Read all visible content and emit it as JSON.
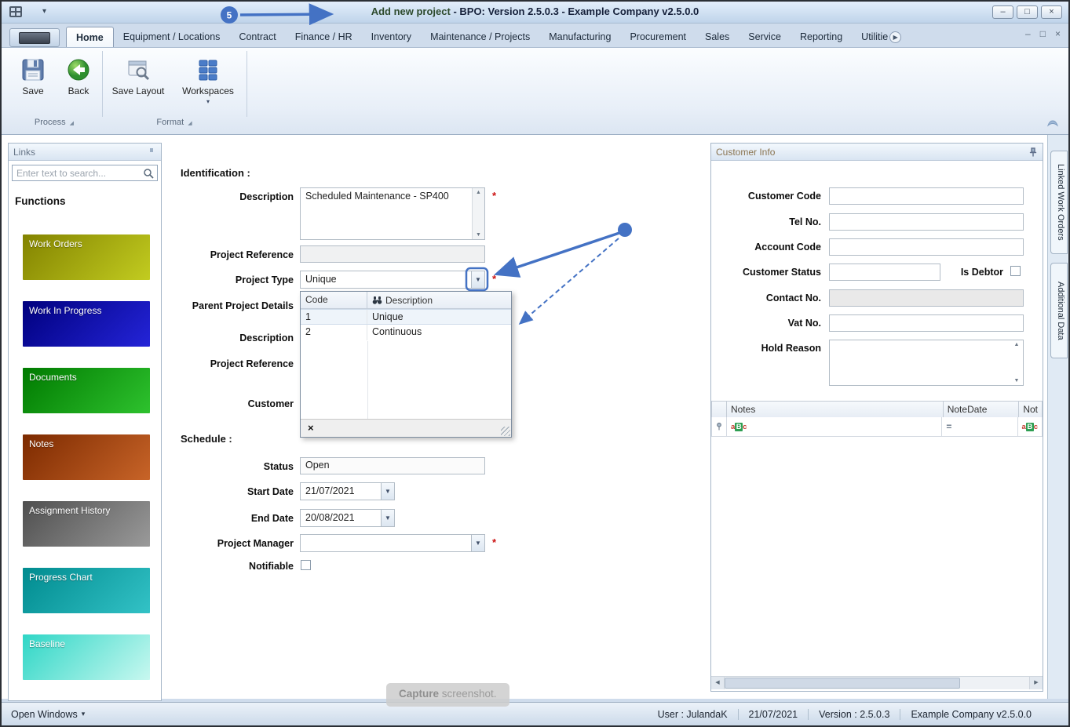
{
  "window": {
    "title_prefix": "Add new project",
    "title_rest": " - BPO: Version 2.5.0.3 - Example Company v2.5.0.0"
  },
  "icons": {
    "minimize": "–",
    "maximize": "□",
    "restore": "□",
    "close": "×",
    "caret_down_small": "▾",
    "dropdown_arrow": "▼",
    "arrow_up": "▲",
    "arrow_down": "▼",
    "arrow_left": "◀",
    "arrow_right": "▶",
    "tab_scroll_right": "▶",
    "dialog_launcher": "◢",
    "close_x": "×",
    "equals": "="
  },
  "ribbon": {
    "tabs": [
      {
        "label": "Home",
        "active": true
      },
      {
        "label": "Equipment / Locations"
      },
      {
        "label": "Contract"
      },
      {
        "label": "Finance / HR"
      },
      {
        "label": "Inventory"
      },
      {
        "label": "Maintenance / Projects"
      },
      {
        "label": "Manufacturing"
      },
      {
        "label": "Procurement"
      },
      {
        "label": "Sales"
      },
      {
        "label": "Service"
      },
      {
        "label": "Reporting"
      },
      {
        "label": "Utilitie"
      }
    ],
    "buttons": {
      "save": "Save",
      "back": "Back",
      "save_layout": "Save Layout",
      "workspaces": "Workspaces"
    },
    "groups": {
      "process": "Process",
      "format": "Format"
    }
  },
  "links": {
    "title": "Links",
    "search_placeholder": "Enter text to search...",
    "heading": "Functions",
    "tiles": [
      {
        "label": "Work Orders",
        "from": "#838300",
        "to": "#c2cc20"
      },
      {
        "label": "Work In Progress",
        "from": "#00007e",
        "to": "#2424d8"
      },
      {
        "label": "Documents",
        "from": "#007a00",
        "to": "#2ec22e"
      },
      {
        "label": "Notes",
        "from": "#7c2a00",
        "to": "#c86428"
      },
      {
        "label": "Assignment History",
        "from": "#4f4f4f",
        "to": "#9a9a9a"
      },
      {
        "label": "Progress Chart",
        "from": "#008b8f",
        "to": "#33c2c6"
      },
      {
        "label": "Baseline",
        "from": "#2fd6c6",
        "to": "#c8f8f0"
      }
    ]
  },
  "form": {
    "section_identification": "Identification :",
    "section_schedule": "Schedule :",
    "required_marker": "*",
    "description_label": "Description",
    "description_value": "Scheduled Maintenance - SP400",
    "project_reference_label": "Project Reference",
    "project_type_label": "Project Type",
    "project_type_value": "Unique",
    "parent_details_label": "Parent Project Details",
    "parent_description_label": "Description",
    "parent_reference_label": "Project Reference",
    "customer_label": "Customer",
    "status_label": "Status",
    "status_value": "Open",
    "start_date_label": "Start Date",
    "start_date_value": "21/07/2021",
    "end_date_label": "End Date",
    "end_date_value": "20/08/2021",
    "project_manager_label": "Project Manager",
    "notifiable_label": "Notifiable",
    "type_dropdown": {
      "col_code": "Code",
      "col_description": "Description",
      "rows": [
        {
          "code": "1",
          "description": "Unique"
        },
        {
          "code": "2",
          "description": "Continuous"
        }
      ]
    }
  },
  "customer_info": {
    "title": "Customer Info",
    "customer_code_label": "Customer Code",
    "tel_no_label": "Tel No.",
    "account_code_label": "Account Code",
    "customer_status_label": "Customer Status",
    "is_debtor_label": "Is Debtor",
    "contact_no_label": "Contact No.",
    "vat_no_label": "Vat No.",
    "hold_reason_label": "Hold Reason",
    "grid": {
      "col_notes": "Notes",
      "col_notedate": "NoteDate",
      "col_not": "Not"
    }
  },
  "side_tabs": {
    "linked_work_orders": "Linked Work Orders",
    "additional_data": "Additional Data"
  },
  "statusbar": {
    "open_windows": "Open Windows",
    "user": "User : JulandaK",
    "date": "21/07/2021",
    "version": "Version : 2.5.0.3",
    "company": "Example Company v2.5.0.0"
  },
  "capture": {
    "bold": "Capture",
    "rest": " screenshot."
  },
  "annotations": {
    "step_number": "5",
    "color": "#4472c4"
  }
}
